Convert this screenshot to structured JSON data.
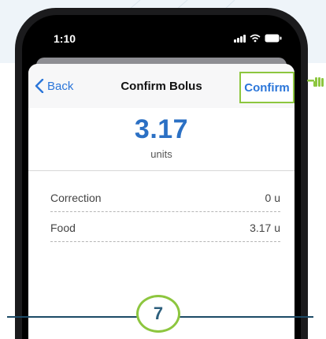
{
  "status_bar": {
    "time": "1:10"
  },
  "nav": {
    "back_label": "Back",
    "title": "Confirm Bolus",
    "confirm_label": "Confirm"
  },
  "bolus": {
    "amount": "3.17",
    "unit_label": "units"
  },
  "rows": [
    {
      "label": "Correction",
      "value": "0 u"
    },
    {
      "label": "Food",
      "value": "3.17 u"
    }
  ],
  "step": {
    "number": "7"
  },
  "colors": {
    "accent": "#2b76d9",
    "highlight": "#8dc63f",
    "amount": "#2b70c4",
    "step_line": "#1c4a66"
  },
  "icons": [
    "chevron-left-icon",
    "signal-icon",
    "wifi-icon",
    "battery-icon",
    "pointing-hand-icon"
  ]
}
